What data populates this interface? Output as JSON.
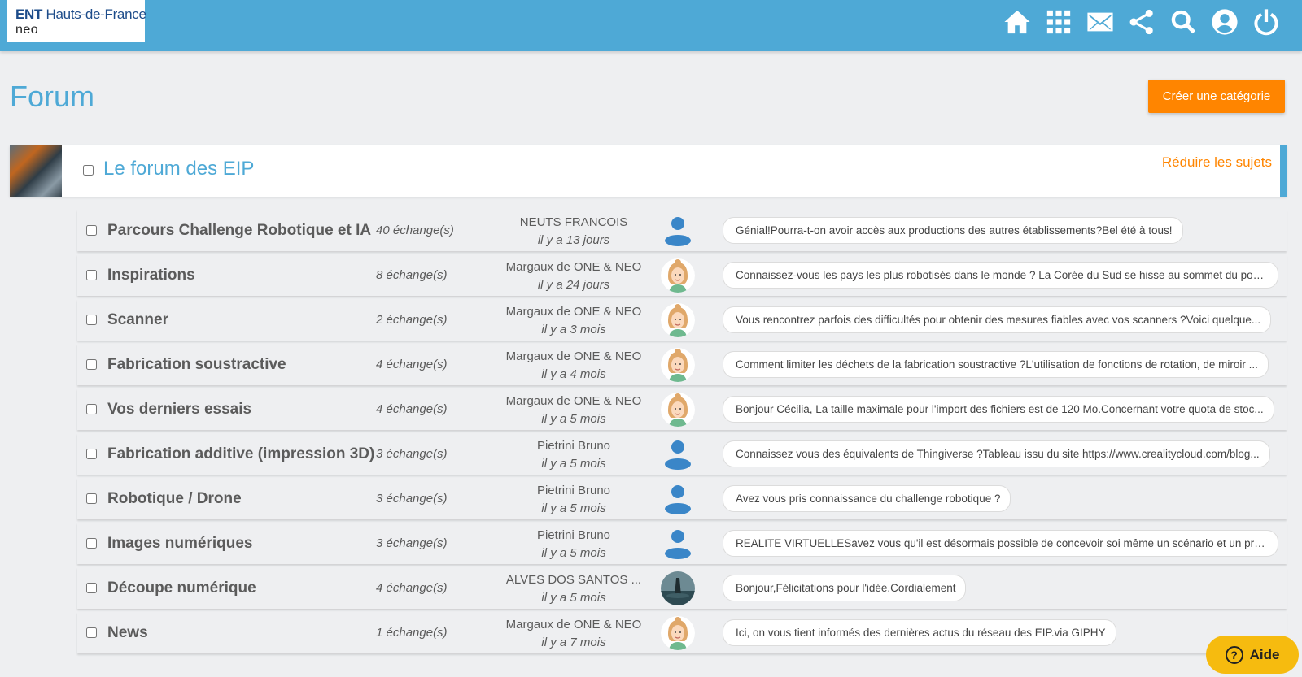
{
  "header": {
    "logo_brand": "ENT",
    "logo_region": "Hauts-de-France",
    "logo_sub": "neo",
    "icons": [
      "home-icon",
      "apps-grid-icon",
      "mail-icon",
      "share-icon",
      "search-icon",
      "profile-icon",
      "power-icon"
    ]
  },
  "page": {
    "title": "Forum",
    "create_label": "Créer une catégorie"
  },
  "category": {
    "title": "Le forum des EIP",
    "collapse_label": "Réduire les sujets"
  },
  "topics": [
    {
      "title": "Parcours Challenge Robotique et IA",
      "count": "40 échange(s)",
      "author": "NEUTS FRANCOIS",
      "time": "il y a 13 jours",
      "avatar": "default",
      "message": "Génial!Pourra-t-on avoir accès aux productions des autres établissements?Bel été à tous!"
    },
    {
      "title": "Inspirations",
      "count": "8 échange(s)",
      "author": "Margaux de ONE & NEO",
      "time": "il y a 24 jours",
      "avatar": "woman",
      "message": "Connaissez-vous les pays les plus robotisés dans le monde ? La Corée du Sud se hisse au sommet du podi..."
    },
    {
      "title": "Scanner",
      "count": "2 échange(s)",
      "author": "Margaux de ONE & NEO",
      "time": "il y a 3 mois",
      "avatar": "woman",
      "message": "Vous rencontrez parfois des difficultés pour obtenir des mesures fiables avec vos scanners ?Voici quelque..."
    },
    {
      "title": "Fabrication soustractive",
      "count": "4 échange(s)",
      "author": "Margaux de ONE & NEO",
      "time": "il y a 4 mois",
      "avatar": "woman",
      "message": "Comment limiter les déchets de la fabrication soustractive ?L'utilisation de fonctions de rotation, de miroir ..."
    },
    {
      "title": "Vos derniers essais",
      "count": "4 échange(s)",
      "author": "Margaux de ONE & NEO",
      "time": "il y a 5 mois",
      "avatar": "woman",
      "message": "Bonjour Cécilia, La taille maximale pour l'import des fichiers est de 120 Mo.Concernant votre quota de stoc..."
    },
    {
      "title": "Fabrication additive (impression 3D)",
      "count": "3 échange(s)",
      "author": "Pietrini Bruno",
      "time": "il y a 5 mois",
      "avatar": "default",
      "message": "Connaissez vous des équivalents de Thingiverse ?Tableau issu du site https://www.crealitycloud.com/blog..."
    },
    {
      "title": "Robotique / Drone",
      "count": "3 échange(s)",
      "author": "Pietrini Bruno",
      "time": "il y a 5 mois",
      "avatar": "default",
      "message": "Avez vous pris connaissance du challenge robotique ?"
    },
    {
      "title": "Images numériques",
      "count": "3 échange(s)",
      "author": "Pietrini Bruno",
      "time": "il y a 5 mois",
      "avatar": "default",
      "message": "REALITE VIRTUELLESavez vous qu'il est désormais possible de concevoir soi même un scénario et un prog..."
    },
    {
      "title": "Découpe numérique",
      "count": "4 échange(s)",
      "author": "ALVES DOS SANTOS ...",
      "time": "il y a 5 mois",
      "avatar": "photo",
      "message": "Bonjour,Félicitations pour l'idée.Cordialement"
    },
    {
      "title": "News",
      "count": "1 échange(s)",
      "author": "Margaux de ONE & NEO",
      "time": "il y a 7 mois",
      "avatar": "woman",
      "message": "Ici, on vous tient informés des dernières actus du réseau des EIP.via GIPHY"
    }
  ],
  "help": {
    "label": "Aide"
  },
  "colors": {
    "primary": "#4ea9d6",
    "accent": "#ff8500",
    "help": "#f6bb0f",
    "background": "#eeeff1"
  }
}
